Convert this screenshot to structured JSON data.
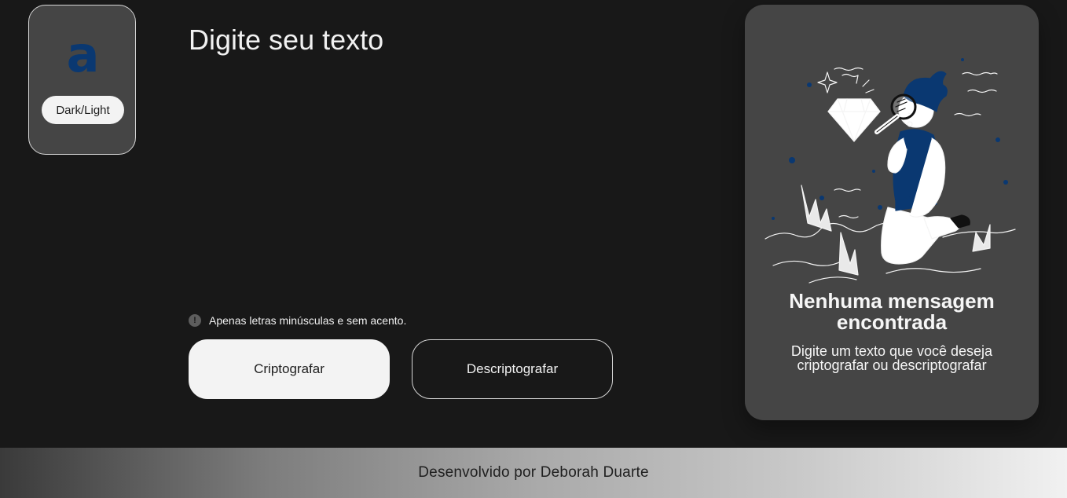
{
  "theme": {
    "accent": "#0a3871",
    "background": "#181818",
    "panel": "#454545",
    "button_light": "#f3f3f3"
  },
  "logo": {
    "glyph": "a",
    "icon": "alura-logo-icon"
  },
  "theme_toggle": {
    "label": "Dark/Light"
  },
  "input": {
    "placeholder": "Digite seu texto",
    "value": ""
  },
  "hint": {
    "icon": "exclamation-circle-icon",
    "glyph": "!",
    "text": "Apenas letras minúsculas e sem acento."
  },
  "actions": {
    "encrypt_label": "Criptografar",
    "decrypt_label": "Descriptografar"
  },
  "output": {
    "illustration": "person-with-magnifying-glass-illustration",
    "title": "Nenhuma mensagem encontrada",
    "subtitle": "Digite um texto que você deseja criptografar ou descriptografar"
  },
  "footer": {
    "text": "Desenvolvido por Deborah Duarte"
  }
}
